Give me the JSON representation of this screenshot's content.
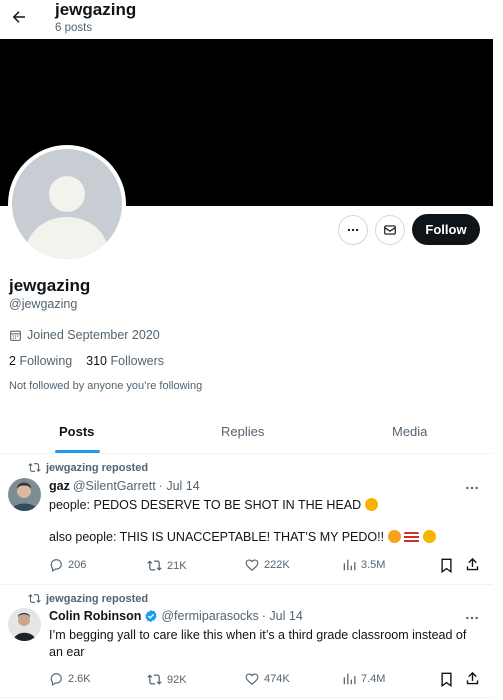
{
  "header": {
    "title": "jewgazing",
    "post_count": "6 posts"
  },
  "actions": {
    "follow_label": "Follow"
  },
  "profile": {
    "display_name": "jewgazing",
    "handle": "@jewgazing",
    "joined": "Joined September 2020",
    "following_count": "2",
    "following_label": "Following",
    "followers_count": "310",
    "followers_label": "Followers",
    "not_followed": "Not followed by anyone you’re following"
  },
  "tabs": [
    {
      "label": "Posts",
      "active": true
    },
    {
      "label": "Replies",
      "active": false
    },
    {
      "label": "Media",
      "active": false
    }
  ],
  "posts": [
    {
      "repost_label": "jewgazing reposted",
      "author_name": "gaz",
      "author_handle": "@SilentGarrett",
      "date": "· Jul 14",
      "line1": "people: PEDOS DESERVE TO BE SHOT IN THE HEAD",
      "line2": "also people: THIS IS UNACCEPTABLE! THAT’S MY PEDO!!",
      "replies": "206",
      "reposts": "21K",
      "likes": "222K",
      "views": "3.5M"
    },
    {
      "repost_label": "jewgazing reposted",
      "author_name": "Colin Robinson",
      "author_handle": "@fermiparasocks",
      "date": "· Jul 14",
      "line1": "I’m begging yall to care like this when it’s a third grade classroom instead of an ear",
      "replies": "2.6K",
      "reposts": "92K",
      "likes": "474K",
      "views": "7.4M"
    }
  ],
  "colors": {
    "accent": "#1d9bf0",
    "text": "#0f1419",
    "muted": "#536471",
    "banner": "#000000"
  }
}
